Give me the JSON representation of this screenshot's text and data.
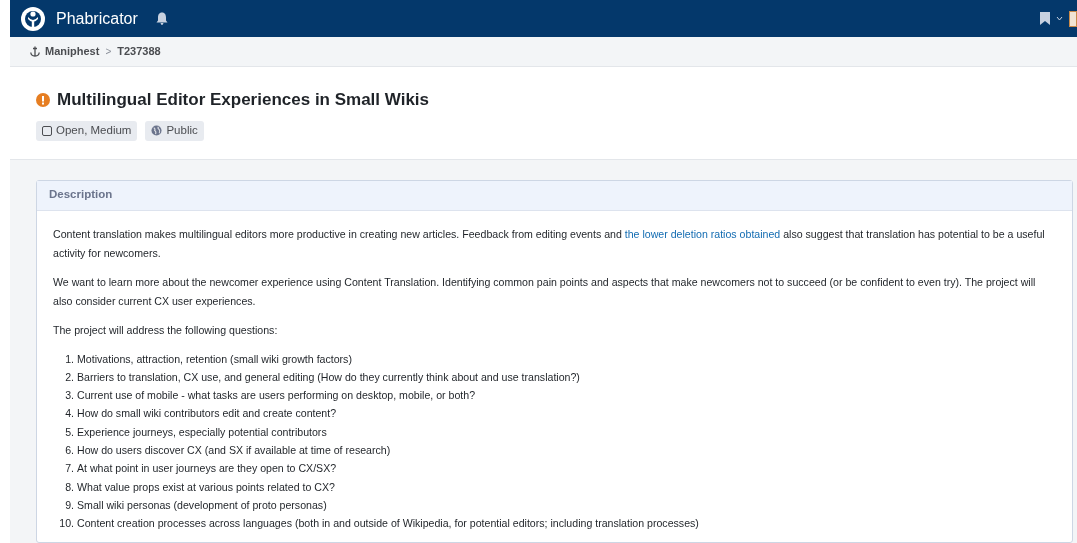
{
  "topbar": {
    "brand": "Phabricator"
  },
  "breadcrumbs": [
    {
      "label": "Maniphest"
    },
    {
      "label": "T237388"
    }
  ],
  "breadcrumb_separator": ">",
  "task": {
    "title": "Multilingual Editor Experiences in Small Wikis",
    "tags": [
      {
        "kind": "status",
        "label": "Open, Medium"
      },
      {
        "kind": "policy",
        "label": "Public"
      }
    ]
  },
  "description": {
    "heading": "Description",
    "paragraphs": [
      {
        "parts": [
          {
            "kind": "text",
            "text": "Content translation makes multilingual editors more productive in creating new articles. Feedback from editing events and "
          },
          {
            "kind": "link",
            "text": "the lower deletion ratios obtained"
          },
          {
            "kind": "text",
            "text": " also suggest that translation has potential to be a useful activity for newcomers."
          }
        ]
      },
      {
        "parts": [
          {
            "kind": "text",
            "text": "We want to learn more about the newcomer experience using Content Translation. Identifying common pain points and aspects that make newcomers not to succeed (or be confident to even try). The project will also consider current CX user experiences."
          }
        ]
      },
      {
        "parts": [
          {
            "kind": "text",
            "text": "The project will address the following questions:"
          }
        ]
      }
    ],
    "questions": [
      {
        "number": "1.",
        "text": "Motivations, attraction, retention (small wiki growth factors)"
      },
      {
        "number": "2.",
        "text": "Barriers to translation, CX use, and general editing (How do they currently think about and use translation?)"
      },
      {
        "number": "3.",
        "text": "Current use of mobile - what tasks are users performing on desktop, mobile, or both?"
      },
      {
        "number": "4.",
        "text": "How do small wiki contributors edit and create content?"
      },
      {
        "number": "5.",
        "text": "Experience journeys, especially potential contributors"
      },
      {
        "number": "6.",
        "text": "How do users discover CX (and SX if available at time of research)"
      },
      {
        "number": "7.",
        "text": "At what point in user journeys are they open to CX/SX?"
      },
      {
        "number": "8.",
        "text": "What value props exist at various points related to CX?"
      },
      {
        "number": "9.",
        "text": "Small wiki personas (development of proto personas)"
      },
      {
        "number": "10.",
        "text": "Content creation processes across languages (both in and outside of Wikipedia, for potential editors; including translation processes)"
      }
    ]
  }
}
